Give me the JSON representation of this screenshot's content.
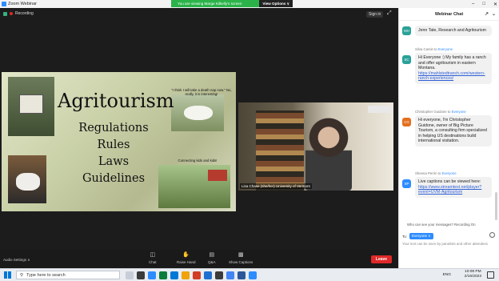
{
  "window": {
    "title": "Zoom Webinar",
    "banner_text": "You are viewing Marge Kilkelly's screen",
    "view_options": "View Options ∨"
  },
  "meeting": {
    "recording": "Recording",
    "sign_in": "Sign in"
  },
  "slide": {
    "title": "Agritourism",
    "items": [
      "Regulations",
      "Rules",
      "Laws",
      "Guidelines"
    ],
    "caption_goats": "\"I think I will take a death nap now.\" No, really, it is interesting!",
    "caption_kids": "Connecting kids and kids!"
  },
  "speaker": {
    "label": "Lisa Chase (she/her) University of Vermont"
  },
  "toolbar": {
    "audio_settings": "Audio Settings ∧",
    "items": [
      {
        "label": "Chat",
        "icon": "chat-icon"
      },
      {
        "label": "Raise Hand",
        "icon": "hand-icon"
      },
      {
        "label": "Q&A",
        "icon": "qa-icon"
      },
      {
        "label": "Show Captions",
        "icon": "cc-icon"
      }
    ],
    "leave": "Leave"
  },
  "chat": {
    "header": "Webinar Chat",
    "messages": [
      {
        "sender": "",
        "to": "",
        "initials": "MH",
        "color": "#2aa198",
        "lines": [
          "Jenn Tate, Research and Agritourism"
        ],
        "link": ""
      },
      {
        "sender": "Silva Carsin to ",
        "to": "Everyone",
        "initials": "SC",
        "color": "#2aa198",
        "lines": [
          "Hi Everyone :) My family has a ranch and offer agritourism in eastern Montana."
        ],
        "link": "https://mahlstedtranch.com/western-ranch-experiences/"
      },
      {
        "sender": "Christopher Guidone to ",
        "to": "Everyone",
        "initials": "CG",
        "color": "#e36f1e",
        "lines": [
          "Hi everyone, I'm Christopher Guidone, owner of Big Picture Tourism, a consulting firm specialized in helping US destinations build international visitation."
        ],
        "link": ""
      },
      {
        "sender": "Sheena Perrin to ",
        "to": "Everyone",
        "initials": "SP",
        "color": "#2d8cff",
        "lines": [
          "Live captions can be viewed here:"
        ],
        "link": "https://www.streamtext.net/player?event=UVM-Agritourism"
      }
    ],
    "who_can_see": "Who can see your messages? Recording On",
    "to_label": "To:",
    "to_value": "Everyone ∨",
    "placeholder": "Your text can be seen by panelists and other attendees"
  },
  "taskbar": {
    "search": "Type here to search",
    "lang": "ENG",
    "time": "10:09 PM",
    "date": "2/16/2023",
    "app_colors": [
      "#c7ced8",
      "#3a3a3a",
      "#2d8cff",
      "#0a7d3c",
      "#0078d7",
      "#f0a30a",
      "#d33c26",
      "#1f6fd1",
      "#3b3b3b",
      "#4285f4",
      "#2b579a",
      "#2d8cff"
    ]
  }
}
